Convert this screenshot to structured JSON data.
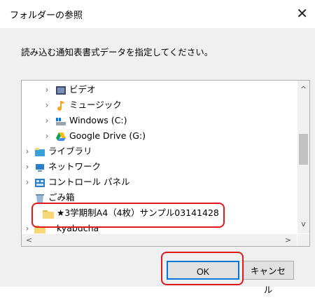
{
  "dialog": {
    "title": "フォルダーの参照",
    "close_glyph": "✕",
    "instruction": "読み込む通知表書式データを指定してください。"
  },
  "tree": {
    "items": [
      {
        "label": "ビデオ",
        "icon": "video-folder-icon",
        "expander": "›"
      },
      {
        "label": "ミュージック",
        "icon": "music-note-icon",
        "expander": "›"
      },
      {
        "label": "Windows (C:)",
        "icon": "windows-drive-icon",
        "expander": "›"
      },
      {
        "label": "Google Drive (G:)",
        "icon": "google-drive-icon",
        "expander": "›"
      },
      {
        "label": "ライブラリ",
        "icon": "library-icon",
        "expander": "›"
      },
      {
        "label": "ネットワーク",
        "icon": "network-icon",
        "expander": "›"
      },
      {
        "label": "コントロール パネル",
        "icon": "control-panel-icon",
        "expander": "›"
      },
      {
        "label": "ごみ箱",
        "icon": "recycle-bin-icon",
        "expander": ""
      },
      {
        "label": "★3学期制A4（4枚）サンプル03141428",
        "icon": "folder-icon",
        "expander": ""
      },
      {
        "label": "kyabucha",
        "icon": "folder-icon",
        "expander": "›"
      }
    ]
  },
  "scroll": {
    "up": "^",
    "down": "v",
    "left": "<",
    "right": ">"
  },
  "buttons": {
    "ok": "OK",
    "cancel": "キャンセル"
  },
  "colors": {
    "highlight": "#e0191b",
    "accent": "#0078d7",
    "folder": "#f8d775"
  }
}
